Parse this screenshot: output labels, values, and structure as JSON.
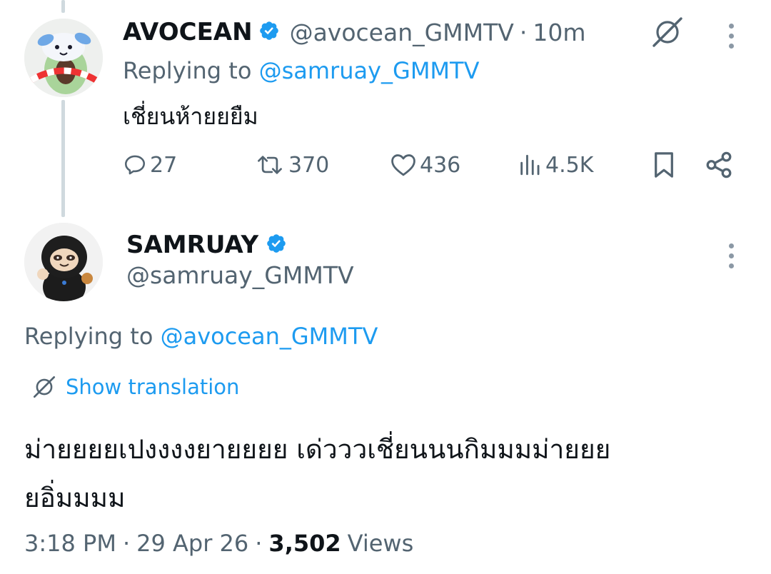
{
  "parent_tweet": {
    "display_name": "AVOCEAN",
    "handle": "@avocean_GMMTV",
    "separator": "·",
    "time_ago": "10m",
    "replying_prefix": "Replying to",
    "replying_to": "@samruay_GMMTV",
    "text": "เชี่ยนห้ายยยืม",
    "actions": {
      "replies": "27",
      "reposts": "370",
      "likes": "436",
      "views": "4.5K"
    }
  },
  "main_tweet": {
    "display_name": "SAMRUAY",
    "handle": "@samruay_GMMTV",
    "replying_prefix": "Replying to",
    "replying_to": "@avocean_GMMTV",
    "show_translation": "Show translation",
    "text_line1": "ม่ายยยยเปงงงงยายยยย เด่ววว​เชี่ยนนนกิมมมม่ายยย",
    "text_line2": "ยอิ่มมมม",
    "time": "3:18 PM",
    "dot1": "·",
    "date": "29 Apr 26",
    "dot2": "·",
    "views_count": "3,502",
    "views_label": "Views"
  },
  "colors": {
    "accent": "#1d9bf0",
    "secondary_text": "#536471",
    "primary_text": "#0f1419",
    "thread_line": "#cfd9de"
  },
  "icons": [
    "verified-badge-icon",
    "translate-icon",
    "more-icon",
    "reply-icon",
    "repost-icon",
    "like-icon",
    "views-icon",
    "bookmark-icon",
    "share-icon"
  ]
}
